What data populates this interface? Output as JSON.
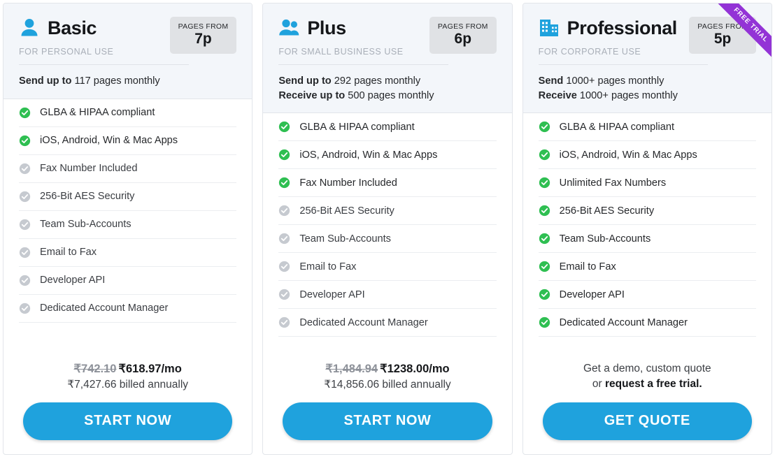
{
  "colors": {
    "accent_blue": "#1fa2dd",
    "check_green": "#2fbf52",
    "check_gray": "#c6cad0",
    "ribbon_purple": "#9333d6",
    "header_bg": "#f3f6fa",
    "badge_bg": "#e0e2e5"
  },
  "plans": [
    {
      "icon": "single-person-icon",
      "name": "Basic",
      "subtitle": "FOR PERSONAL USE",
      "badge_label": "PAGES FROM",
      "badge_value": "7p",
      "ribbon": null,
      "quota": [
        {
          "bold": "Send up to",
          "rest": "117 pages monthly"
        }
      ],
      "features": [
        {
          "label": "GLBA & HIPAA compliant",
          "included": true
        },
        {
          "label": "iOS, Android, Win & Mac Apps",
          "included": true
        },
        {
          "label": "Fax Number Included",
          "included": false
        },
        {
          "label": "256-Bit AES Security",
          "included": false
        },
        {
          "label": "Team Sub-Accounts",
          "included": false
        },
        {
          "label": "Email to Fax",
          "included": false
        },
        {
          "label": "Developer API",
          "included": false
        },
        {
          "label": "Dedicated Account Manager",
          "included": false
        }
      ],
      "price": {
        "type": "price",
        "old": "₹742.10",
        "new": "₹618.97/mo",
        "annual": "₹7,427.66 billed annually"
      },
      "cta": "START NOW"
    },
    {
      "icon": "two-people-icon",
      "name": "Plus",
      "subtitle": "FOR SMALL BUSINESS USE",
      "badge_label": "PAGES FROM",
      "badge_value": "6p",
      "ribbon": null,
      "quota": [
        {
          "bold": "Send up to",
          "rest": "292 pages monthly"
        },
        {
          "bold": "Receive up to",
          "rest": "500 pages monthly"
        }
      ],
      "features": [
        {
          "label": "GLBA & HIPAA compliant",
          "included": true
        },
        {
          "label": "iOS, Android, Win & Mac Apps",
          "included": true
        },
        {
          "label": "Fax Number Included",
          "included": true
        },
        {
          "label": "256-Bit AES Security",
          "included": false
        },
        {
          "label": "Team Sub-Accounts",
          "included": false
        },
        {
          "label": "Email to Fax",
          "included": false
        },
        {
          "label": "Developer API",
          "included": false
        },
        {
          "label": "Dedicated Account Manager",
          "included": false
        }
      ],
      "price": {
        "type": "price",
        "old": "₹1,484.94",
        "new": "₹1238.00/mo",
        "annual": "₹14,856.06 billed annually"
      },
      "cta": "START NOW"
    },
    {
      "icon": "office-building-icon",
      "name": "Professional",
      "subtitle": "FOR CORPORATE USE",
      "badge_label": "PAGES FROM",
      "badge_value": "5p",
      "ribbon": "FREE TRIAL",
      "quota": [
        {
          "bold": "Send",
          "rest": "1000+ pages monthly"
        },
        {
          "bold": "Receive",
          "rest": "1000+ pages monthly"
        }
      ],
      "features": [
        {
          "label": "GLBA & HIPAA compliant",
          "included": true
        },
        {
          "label": "iOS, Android, Win & Mac Apps",
          "included": true
        },
        {
          "label": "Unlimited Fax Numbers",
          "included": true
        },
        {
          "label": "256-Bit AES Security",
          "included": true
        },
        {
          "label": "Team Sub-Accounts",
          "included": true
        },
        {
          "label": "Email to Fax",
          "included": true
        },
        {
          "label": "Developer API",
          "included": true
        },
        {
          "label": "Dedicated Account Manager",
          "included": true
        }
      ],
      "price": {
        "type": "quote",
        "line1": "Get a demo, custom quote",
        "line2_prefix": "or ",
        "line2_bold": "request a free trial."
      },
      "cta": "GET QUOTE"
    }
  ]
}
